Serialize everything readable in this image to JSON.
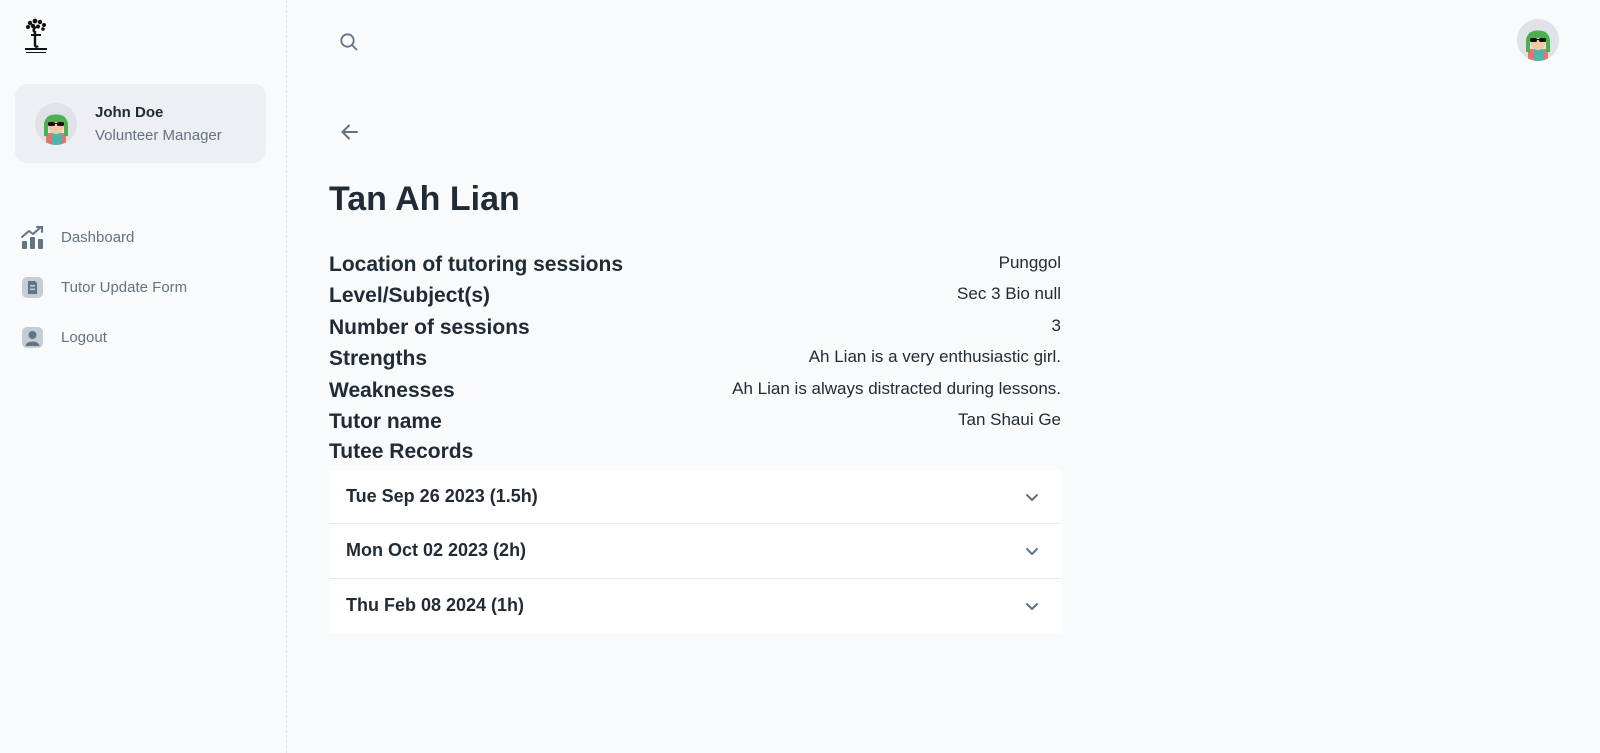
{
  "account": {
    "name": "John Doe",
    "role": "Volunteer Manager"
  },
  "nav": {
    "items": [
      {
        "label": "Dashboard",
        "icon": "chart-icon"
      },
      {
        "label": "Tutor Update Form",
        "icon": "form-icon"
      },
      {
        "label": "Logout",
        "icon": "user-icon"
      }
    ]
  },
  "page": {
    "title": "Tan Ah Lian",
    "records_title": "Tutee Records"
  },
  "details": [
    {
      "label": "Location of tutoring sessions",
      "value": "Punggol"
    },
    {
      "label": "Level/Subject(s)",
      "value": "Sec 3 Bio null"
    },
    {
      "label": "Number of sessions",
      "value": "3"
    },
    {
      "label": "Strengths",
      "value": "Ah Lian is a very enthusiastic girl."
    },
    {
      "label": "Weaknesses",
      "value": "Ah Lian is always distracted during lessons."
    },
    {
      "label": "Tutor name",
      "value": "Tan Shaui Ge"
    }
  ],
  "records": [
    {
      "label": "Tue Sep 26 2023 (1.5h)"
    },
    {
      "label": "Mon Oct 02 2023 (2h)"
    },
    {
      "label": "Thu Feb 08 2024 (1h)"
    }
  ],
  "colors": {
    "background": "#f9fafb",
    "text_primary": "#212b36",
    "text_secondary": "#637381",
    "account_card": "#edeff2",
    "avatar_hair": "#4caf50",
    "avatar_shirt": "#e57373"
  }
}
